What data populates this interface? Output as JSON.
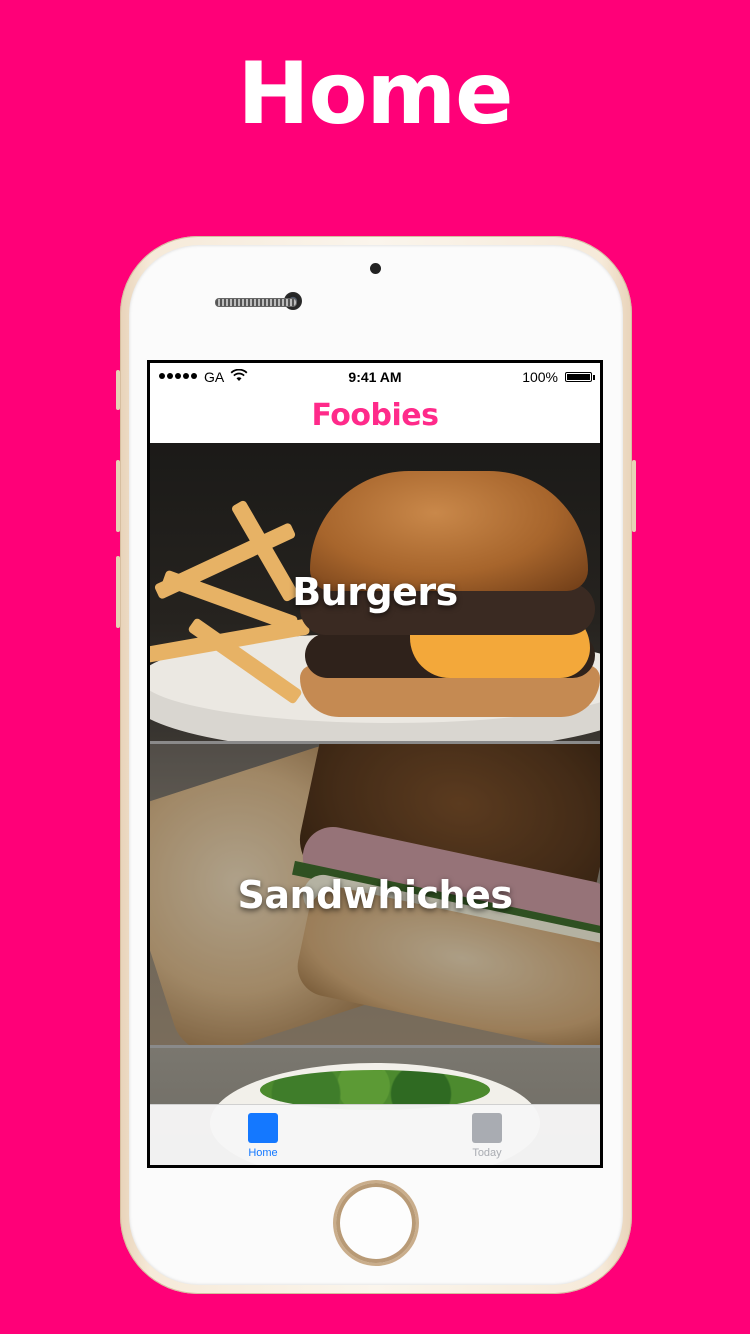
{
  "headline": "Home",
  "status_bar": {
    "carrier": "GA",
    "time": "9:41 AM",
    "battery": "100%"
  },
  "app": {
    "title": "Foobies"
  },
  "categories": [
    {
      "label": "Burgers"
    },
    {
      "label": "Sandwhiches"
    },
    {
      "label": ""
    }
  ],
  "tabs": [
    {
      "label": "Home",
      "active": true,
      "icon": "square-icon",
      "color": "#1478ff"
    },
    {
      "label": "Today",
      "active": false,
      "icon": "square-icon",
      "color": "#a9acb2"
    }
  ],
  "colors": {
    "background": "#ff0078",
    "brand": "#ff2a8a",
    "tab_active": "#1478ff",
    "tab_inactive": "#a9acb2"
  }
}
